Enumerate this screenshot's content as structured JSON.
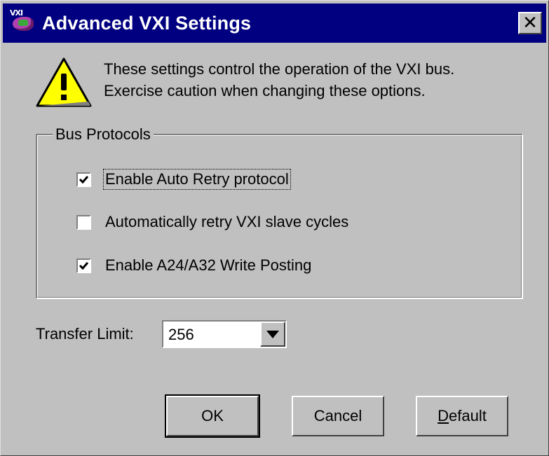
{
  "window": {
    "title": "Advanced VXI Settings",
    "app_icon": "vxi-chip-icon",
    "app_icon_tag": "VXI",
    "close_glyph": "✕"
  },
  "warning": {
    "icon": "warning-icon",
    "line1": "These settings control the operation of the VXI bus.",
    "line2": "Exercise caution when changing these options."
  },
  "bus_protocols": {
    "label": "Bus Protocols",
    "options": [
      {
        "label": "Enable Auto Retry protocol",
        "checked": true
      },
      {
        "label": "Automatically retry VXI slave cycles",
        "checked": false
      },
      {
        "label": "Enable A24/A32 Write Posting",
        "checked": true
      }
    ]
  },
  "transfer_limit": {
    "label": "Transfer Limit:",
    "value": "256"
  },
  "buttons": {
    "ok": "OK",
    "cancel": "Cancel",
    "default_prefix": "D",
    "default_rest": "efault"
  },
  "colors": {
    "titlebar": "#000080",
    "face": "#c0c0c0",
    "warning_fill": "#ffff00"
  }
}
